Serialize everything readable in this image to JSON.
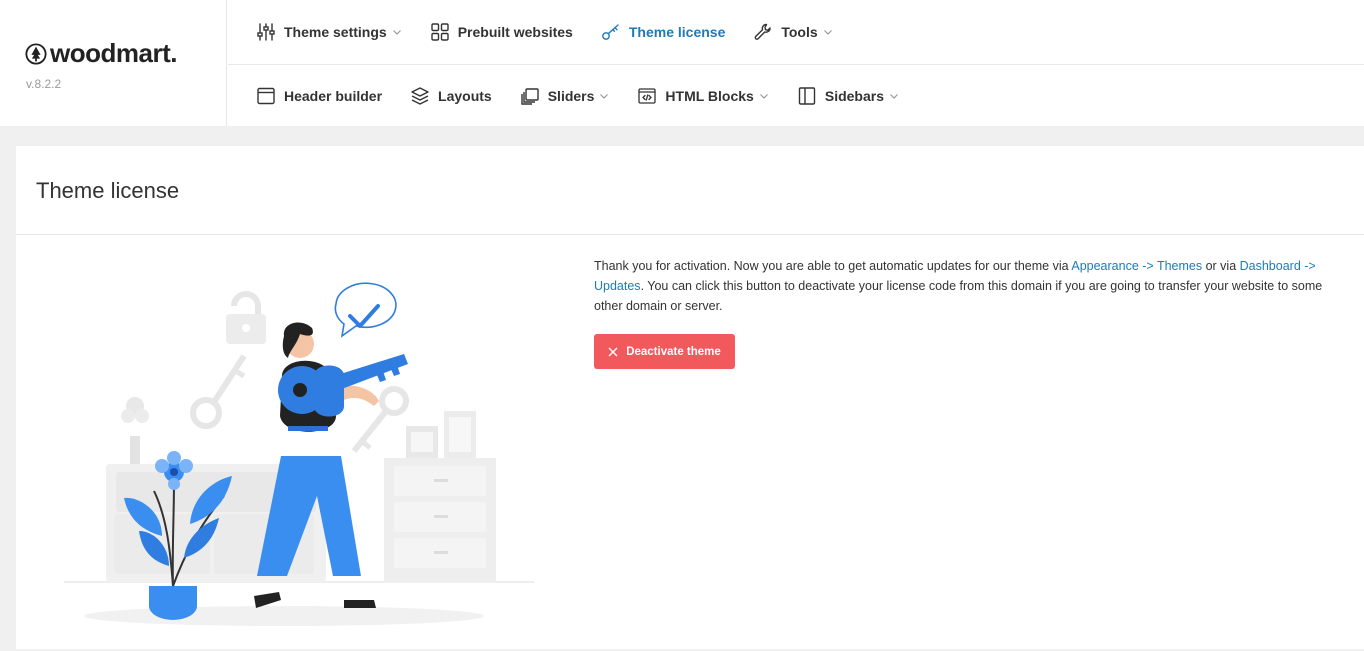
{
  "brand": {
    "logo_text": "woodmart.",
    "version": "v.8.2.2"
  },
  "nav": {
    "row1": [
      {
        "label": "Theme settings",
        "icon": "sliders-icon",
        "dropdown": true
      },
      {
        "label": "Prebuilt websites",
        "icon": "grid-icon",
        "dropdown": false
      },
      {
        "label": "Theme license",
        "icon": "key-icon",
        "dropdown": false,
        "active": true
      },
      {
        "label": "Tools",
        "icon": "wrench-icon",
        "dropdown": true
      }
    ],
    "row2": [
      {
        "label": "Header builder",
        "icon": "window-icon",
        "dropdown": false
      },
      {
        "label": "Layouts",
        "icon": "layers-icon",
        "dropdown": false
      },
      {
        "label": "Sliders",
        "icon": "slides-icon",
        "dropdown": true
      },
      {
        "label": "HTML Blocks",
        "icon": "code-block-icon",
        "dropdown": true
      },
      {
        "label": "Sidebars",
        "icon": "sidebar-icon",
        "dropdown": true
      }
    ]
  },
  "page": {
    "title": "Theme license",
    "message": {
      "part1": "Thank you for activation. Now you are able to get automatic updates for our theme via ",
      "link1": "Appearance -> Themes",
      "part2": " or via ",
      "link2": "Dashboard -> Updates",
      "part3": ". You can click this button to deactivate your license code from this domain if you are going to transfer your website to some other domain or server."
    },
    "deactivate_label": "Deactivate theme"
  },
  "colors": {
    "accent": "#1d7bb5",
    "danger": "#f1595c",
    "illustration_blue": "#3a8ef0"
  }
}
